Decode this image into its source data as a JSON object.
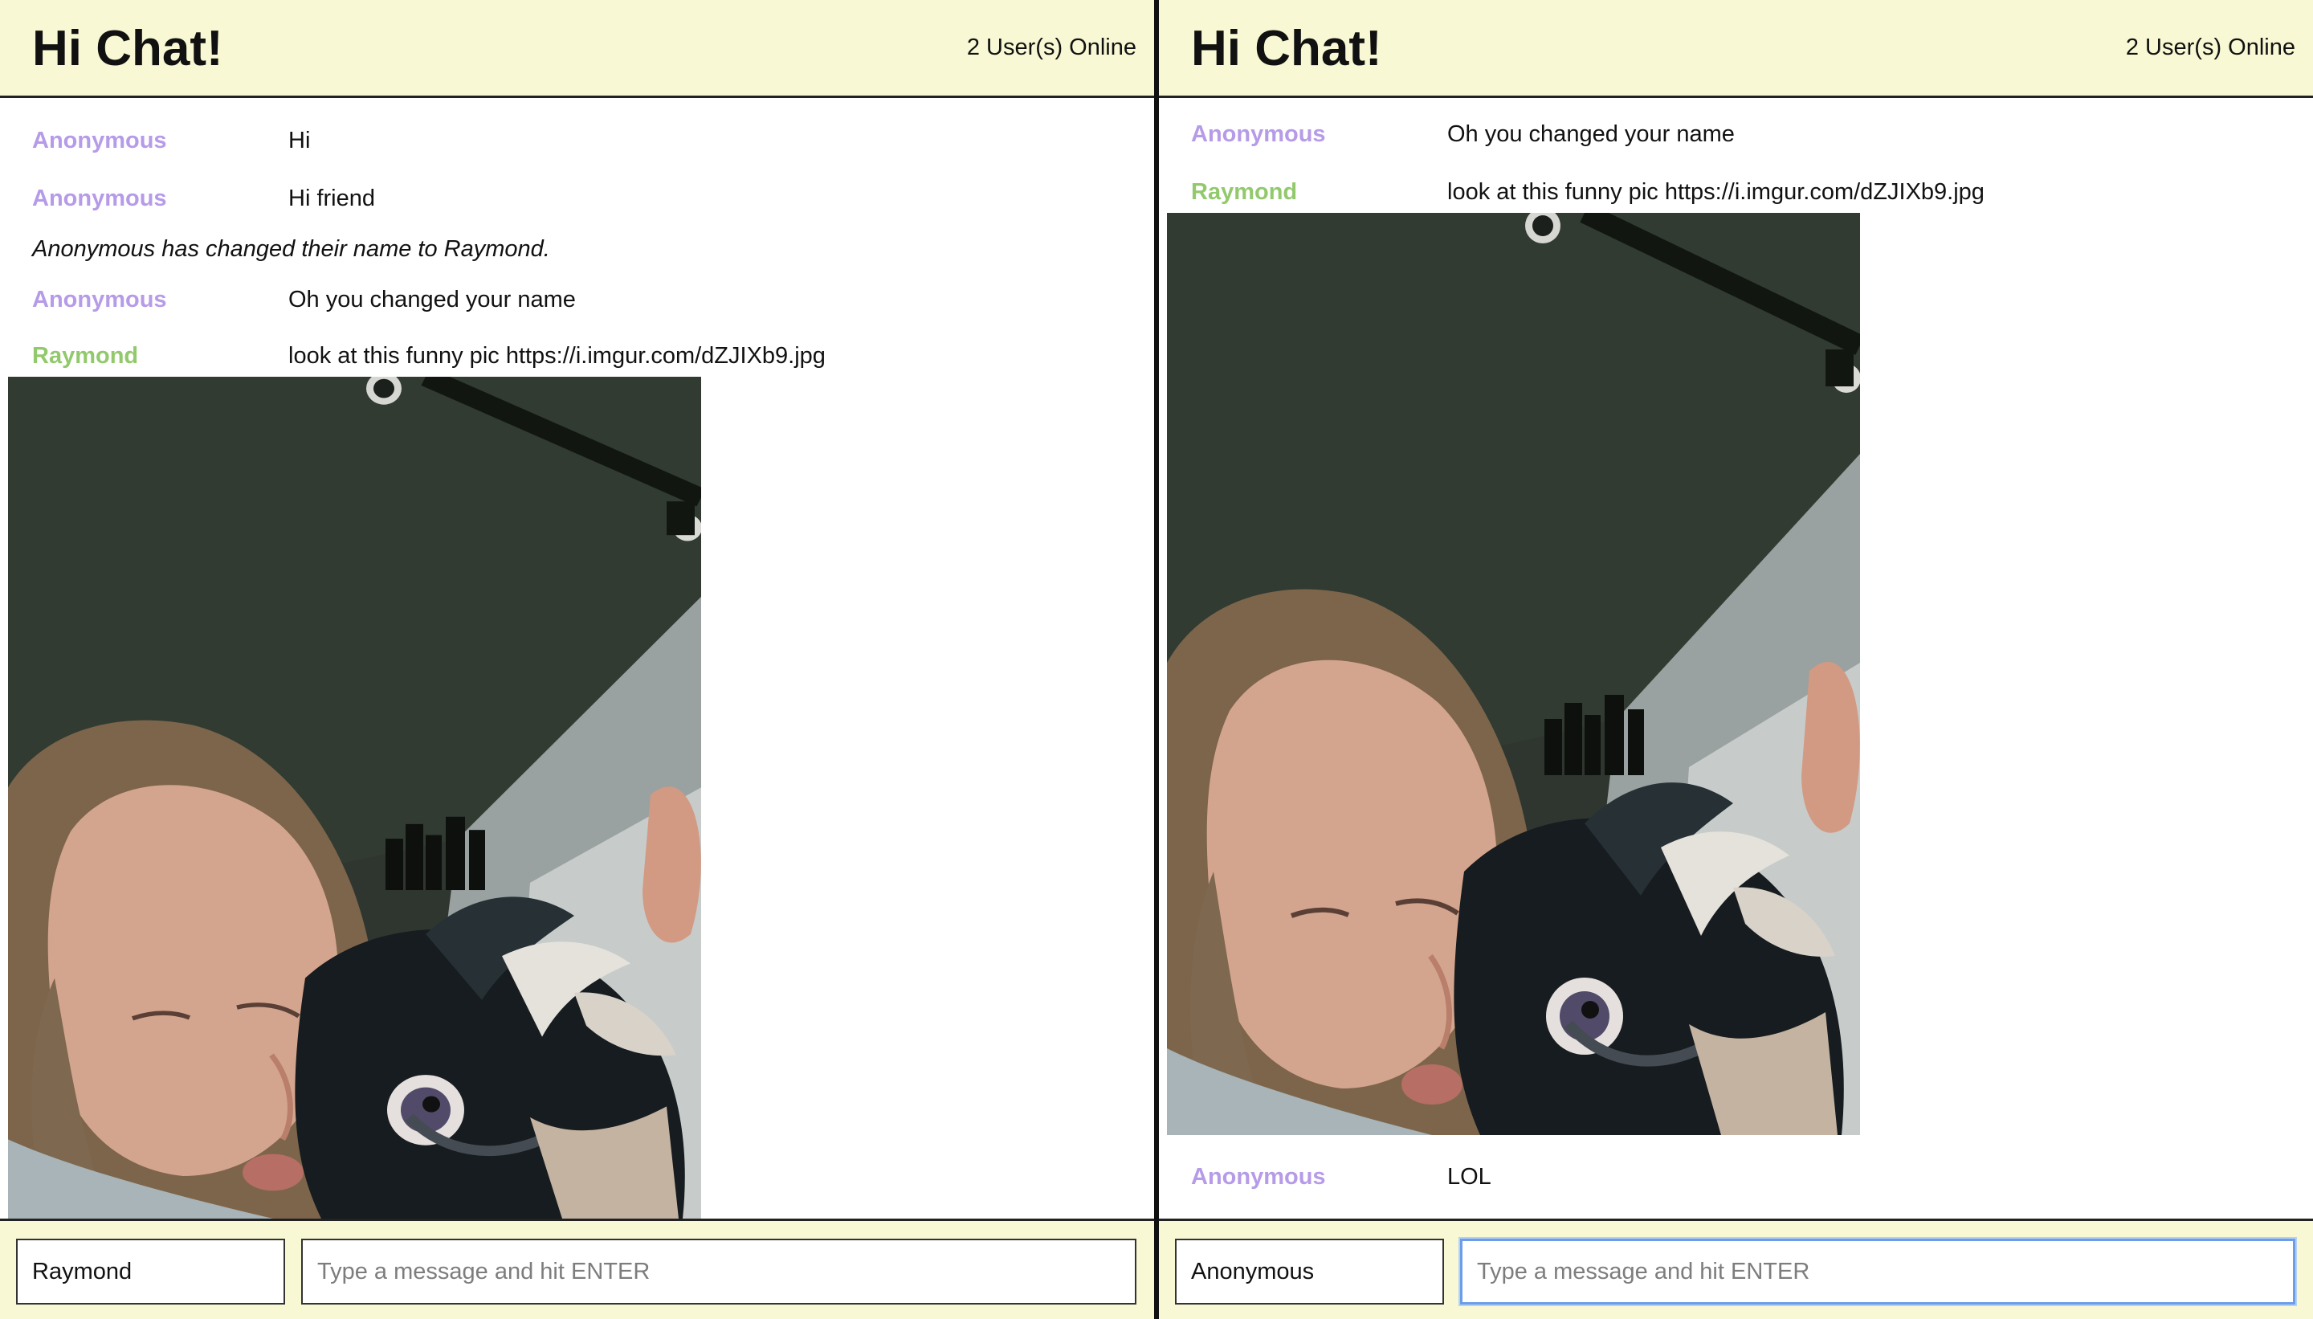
{
  "app": {
    "title": "Hi Chat!",
    "online_status": "2 User(s) Online",
    "colors": {
      "header_background": "#f8f8d4",
      "anonymous_name": "#b69be8",
      "raymond_name": "#93c96d",
      "divider": "#111111",
      "focus_outline": "#6b9ee8"
    }
  },
  "left_pane": {
    "header": {
      "title": "Hi Chat!",
      "online_status": "2 User(s) Online"
    },
    "messages": [
      {
        "author": "Anonymous",
        "text": "Hi"
      },
      {
        "author": "Anonymous",
        "text": "Hi friend"
      },
      {
        "system_text": "Anonymous has changed their name to Raymond."
      },
      {
        "author": "Anonymous",
        "text": "Oh you changed your name"
      },
      {
        "author": "Raymond",
        "text": "look at this funny pic https://i.imgur.com/dZJIXb9.jpg"
      }
    ],
    "image": {
      "description": "photo of a woman kissing a black dog"
    },
    "composer": {
      "name_value": "Raymond",
      "message_placeholder": "Type a message and hit ENTER"
    }
  },
  "right_pane": {
    "header": {
      "title": "Hi Chat!",
      "online_status": "2 User(s) Online"
    },
    "messages": [
      {
        "author": "Anonymous",
        "text": "Oh you changed your name"
      },
      {
        "author": "Raymond",
        "text": "look at this funny pic https://i.imgur.com/dZJIXb9.jpg"
      },
      {
        "author": "Anonymous",
        "text": "LOL"
      }
    ],
    "image": {
      "description": "photo of a woman kissing a black dog"
    },
    "composer": {
      "name_value": "Anonymous",
      "message_placeholder": "Type a message and hit ENTER"
    }
  }
}
